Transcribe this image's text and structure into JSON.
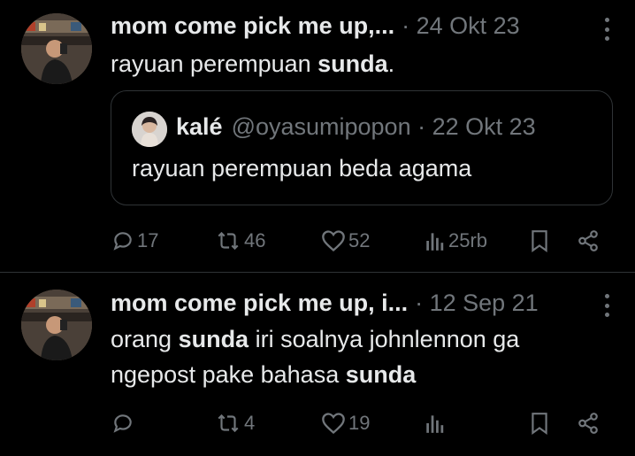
{
  "colors": {
    "background": "#000000",
    "text": "#e7e9ea",
    "muted": "#71767b",
    "border": "#2f3336"
  },
  "tweets": [
    {
      "author_name": "mom come pick me up,...",
      "date": "· 24 Okt 23",
      "text_parts": [
        "rayuan perempuan ",
        "sunda",
        "."
      ],
      "quote": {
        "author_name": "kalé",
        "handle_date": "@oyasumipopon · 22 Okt 23",
        "text": "rayuan perempuan beda agama"
      },
      "actions": {
        "replies": "17",
        "reposts": "46",
        "likes": "52",
        "views": "25rb"
      }
    },
    {
      "author_name": "mom come pick me up, i...",
      "date": "· 12 Sep 21",
      "text_parts": [
        "orang ",
        "sunda",
        " iri soalnya johnlennon ga",
        "ngepost pake bahasa ",
        "sunda"
      ],
      "actions": {
        "replies": "",
        "reposts": "4",
        "likes": "19",
        "views": ""
      }
    }
  ]
}
